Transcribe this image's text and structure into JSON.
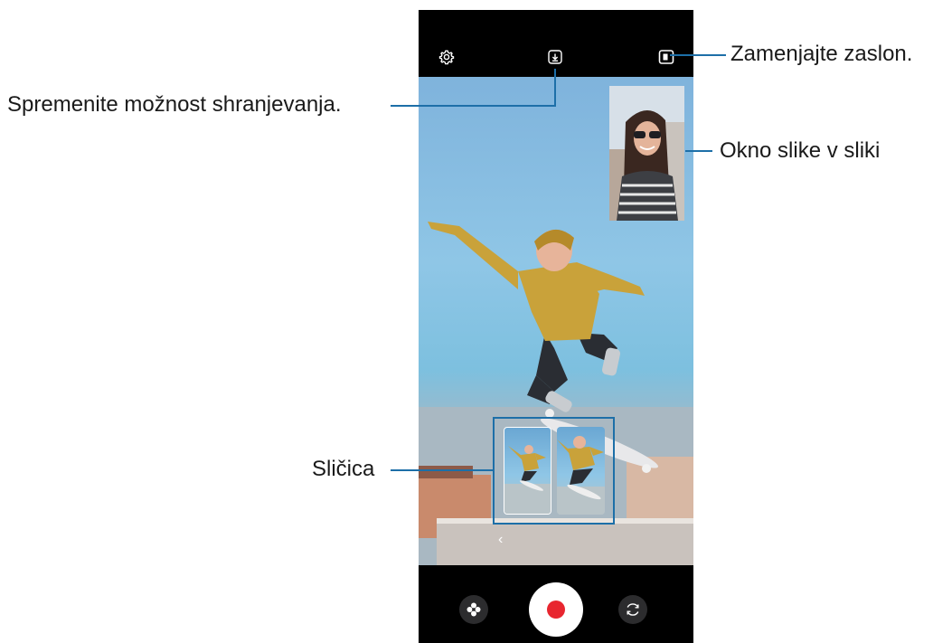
{
  "callouts": {
    "switch_screen": "Zamenjajte zaslon.",
    "save_option": "Spremenite možnost shranjevanja.",
    "pip_window": "Okno slike v sliki",
    "thumbnail": "Sličica"
  },
  "camera": {
    "icons": {
      "settings": "gear-icon",
      "save_option": "download-icon",
      "switch_screen": "screen-switch-icon",
      "effects": "flower-icon",
      "record": "record-icon",
      "flip": "camera-flip-icon",
      "back": "chevron-left-icon"
    },
    "back_glyph": "‹"
  },
  "colors": {
    "accent_line": "#1d6fa8",
    "record_red": "#e8262f",
    "bar_bg": "#000000"
  }
}
